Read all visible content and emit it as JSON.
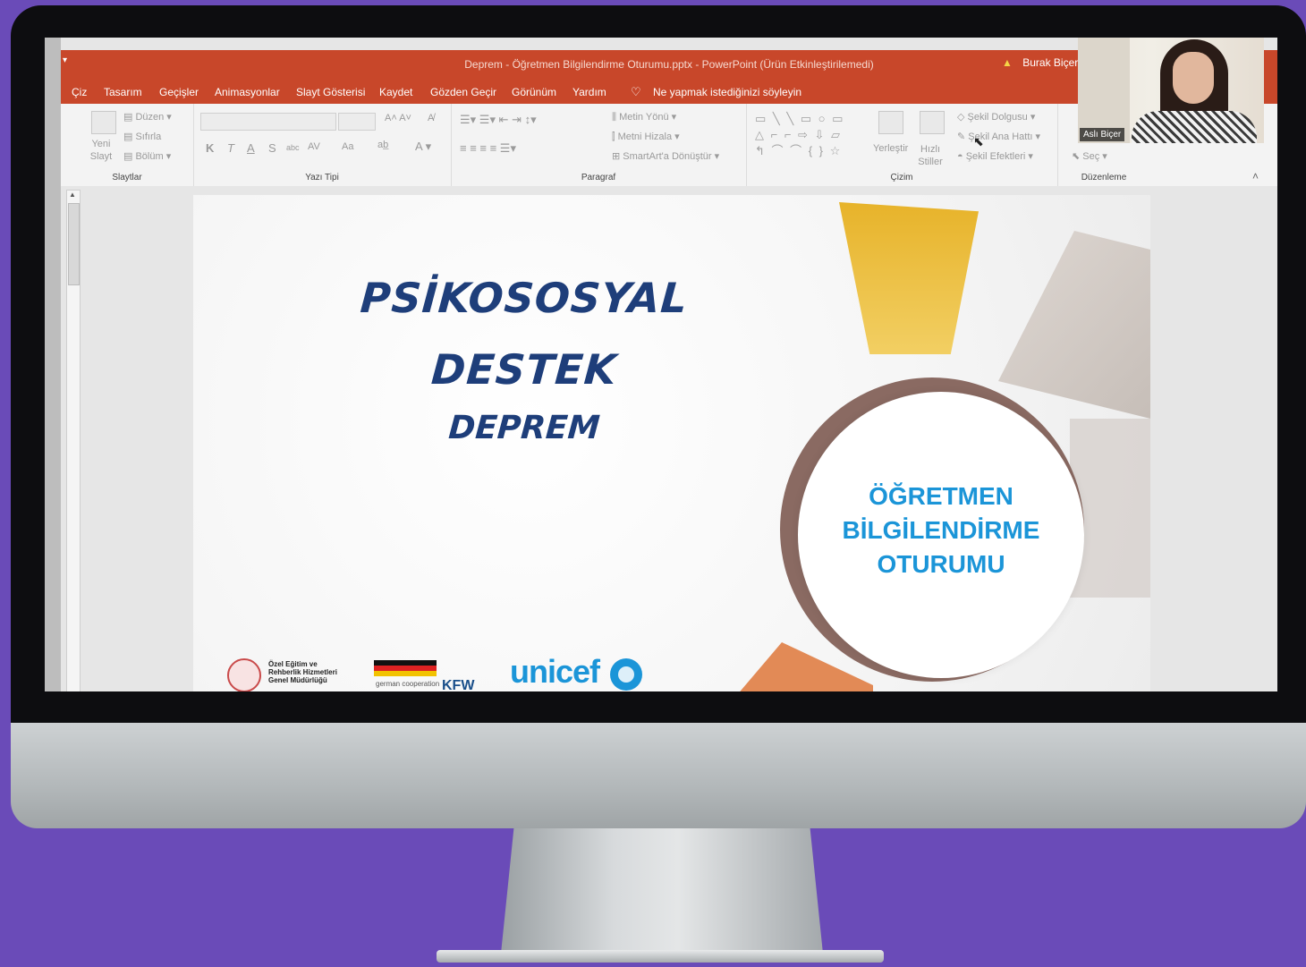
{
  "window": {
    "title": "Deprem - Öğretmen Bilgilendirme Oturumu.pptx  -  PowerPoint (Ürün Etkinleştirilemedi)",
    "user": "Burak Biçer"
  },
  "menu": {
    "items": [
      "Çiz",
      "Tasarım",
      "Geçişler",
      "Animasyonlar",
      "Slayt Gösterisi",
      "Kaydet",
      "Gözden Geçir",
      "Görünüm",
      "Yardım"
    ],
    "tell_me": "Ne yapmak istediğinizi söyleyin"
  },
  "ribbon": {
    "slides": {
      "title": "Slaytlar",
      "new_slide": "Yeni Slayt",
      "layout": "Düzen",
      "reset": "Sıfırla",
      "section": "Bölüm"
    },
    "font": {
      "title": "Yazı Tipi",
      "bold": "K",
      "italic": "T",
      "underline": "A",
      "strike": "S",
      "case": "Aa",
      "spacing": "AV"
    },
    "paragraph": {
      "title": "Paragraf",
      "text_direction": "Metin Yönü",
      "align_text": "Metni Hizala",
      "smartart": "SmartArt'a Dönüştür"
    },
    "drawing": {
      "title": "Çizim",
      "arrange": "Yerleştir",
      "quick_styles": "Hızlı Stiller",
      "fill": "Şekil Dolgusu",
      "outline": "Şekil Ana Hattı",
      "effects": "Şekil Efektleri"
    },
    "editing": {
      "title": "Düzenleme",
      "select": "Seç"
    }
  },
  "slide": {
    "title_line1": "PSİKOSOSYAL",
    "title_line2": "DESTEK",
    "title_line3": "DEPREM",
    "circle_line1": "ÖĞRETMEN",
    "circle_line2": "BİLGİLENDİRME",
    "circle_line3": "OTURUMU",
    "logo_meb": "Özel Eğitim ve Rehberlik Hizmetleri Genel Müdürlüğü",
    "logo_german": "german cooperation",
    "logo_kfw": "KFW",
    "logo_unicef": "unicef"
  },
  "webcam": {
    "name": "Aslı Biçer"
  },
  "colors": {
    "background": "#6a4bb8",
    "ribbon_accent": "#c8472a",
    "slide_title": "#1e3e7a",
    "circle_text": "#1b95d8"
  }
}
